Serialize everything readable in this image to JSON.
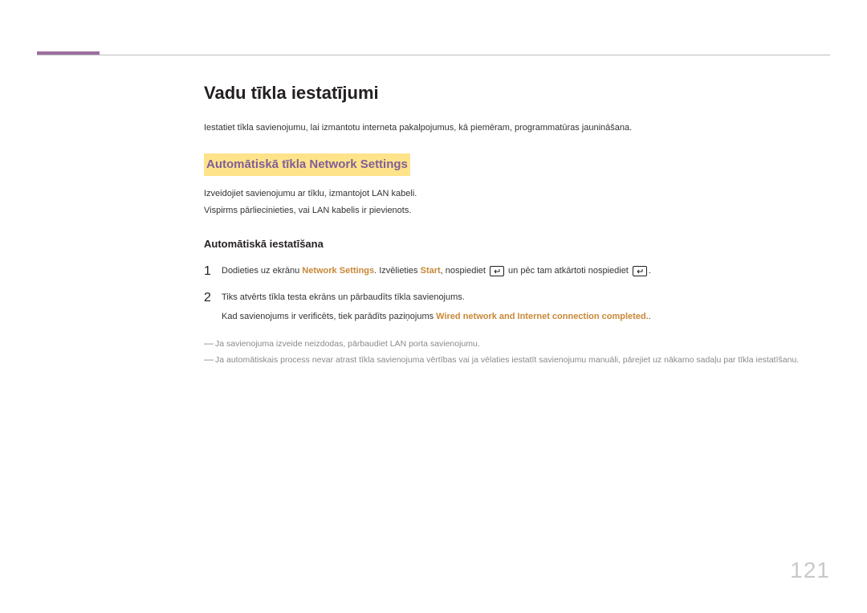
{
  "title": "Vadu tīkla iestatījumi",
  "intro": "Iestatiet tīkla savienojumu, lai izmantotu interneta pakalpojumus, kā piemēram, programmatūras jaunināšana.",
  "section_heading": "Automātiskā tīkla Network Settings",
  "para1": "Izveidojiet savienojumu ar tīklu, izmantojot LAN kabeli.",
  "para2": "Vispirms pārliecinieties, vai LAN kabelis ir pievienots.",
  "subheading": "Automātiskā iestatīšana",
  "step1": {
    "num": "1",
    "prefix": "Dodieties uz ekrānu ",
    "accent1": "Network Settings",
    "mid1": ". Izvēlieties ",
    "accent2": "Start",
    "mid2": ", nospiediet ",
    "mid3": " un pēc tam atkārtoti nospiediet ",
    "suffix": "."
  },
  "step2": {
    "num": "2",
    "line1": "Tiks atvērts tīkla testa ekrāns un pārbaudīts tīkla savienojums.",
    "line2_prefix": "Kad savienojums ir verificēts, tiek parādīts paziņojums ",
    "line2_accent": "Wired network and Internet connection completed.",
    "line2_suffix": "."
  },
  "note1": "Ja savienojuma izveide neizdodas, pārbaudiet LAN porta savienojumu.",
  "note2": "Ja automātiskais process nevar atrast tīkla savienojuma vērtības vai ja vēlaties iestatīt savienojumu manuāli, pārejiet uz nākamo sadaļu par tīkla iestatīšanu.",
  "page_number": "121"
}
